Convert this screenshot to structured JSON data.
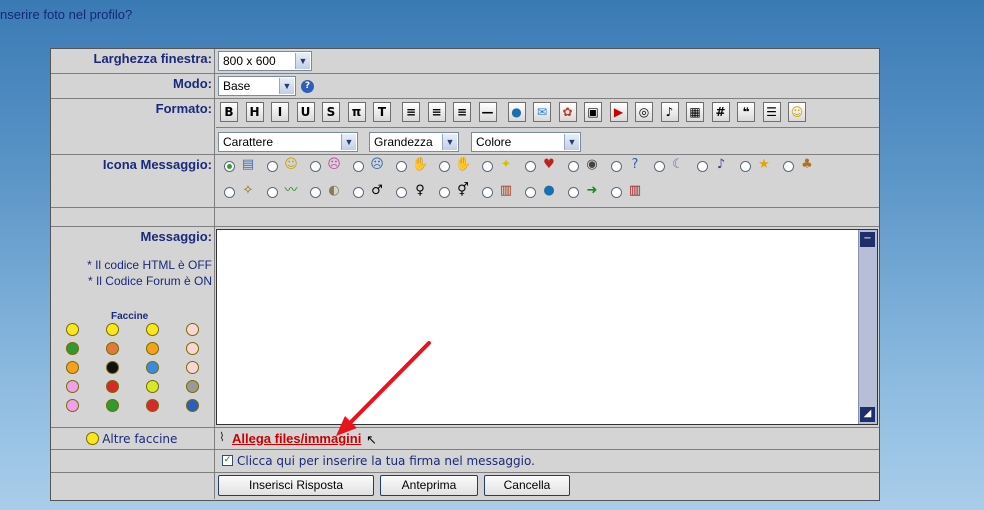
{
  "page": {
    "top_text": "nserire foto nel profilo?"
  },
  "form": {
    "window_label": "Larghezza finestra:",
    "window_value": "800 x 600",
    "mode_label": "Modo:",
    "mode_value": "Base",
    "format_label": "Formato:",
    "toolbar": [
      "bold-icon",
      "heading-icon",
      "italic-icon",
      "underline-icon",
      "strikethrough-icon",
      "pi-icon",
      "teletype-icon",
      "align-left-icon",
      "align-center-icon",
      "align-right-icon",
      "horizontal-rule-icon",
      "globe-link-icon",
      "email-icon",
      "flash-icon",
      "image-icon",
      "youtube-icon",
      "wmv-icon",
      "mp3-icon",
      "table-icon",
      "hash-icon",
      "quote-icon",
      "list-icon",
      "smiley-icon"
    ],
    "font_value": "Carattere",
    "size_value": "Grandezza",
    "color_value": "Colore",
    "icon_label": "Icona Messaggio:",
    "message_label": "Messaggio:",
    "html_note": "* Il codice HTML è OFF",
    "forum_note": "* Il Codice Forum è ON",
    "smileys_title": "Faccine",
    "more_smileys": "Altre faccine",
    "attach_link": "Allega files/immagini",
    "signature_text": "Clicca qui per inserire la tua firma nel messaggio.",
    "submit_button": "Inserisci Risposta",
    "preview_button": "Anteprima",
    "cancel_button": "Cancella"
  },
  "colors": {
    "label": "#1a2a7a",
    "link": "#cc0000",
    "arrow": "#e8141b"
  }
}
